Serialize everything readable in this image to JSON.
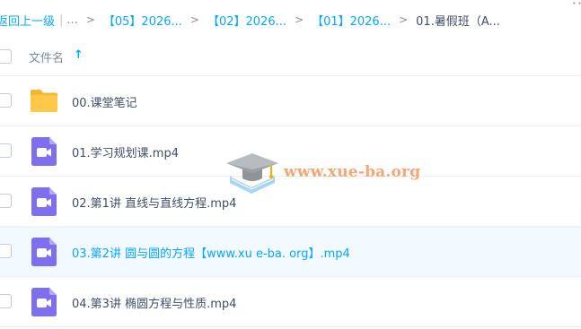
{
  "breadcrumb": {
    "back_label": "返回上一级",
    "divider": "|",
    "ellipsis": "...",
    "separator": ">",
    "items": [
      {
        "label": "【05】2026..."
      },
      {
        "label": "【02】2026..."
      },
      {
        "label": "【01】2026..."
      },
      {
        "label": "01.暑假班（A..."
      }
    ],
    "more_dots": "··"
  },
  "list_header": {
    "name_column": "文件名",
    "sort_icon": "arrow-up-icon",
    "sort_glyph": "↑"
  },
  "rows": [
    {
      "type": "folder",
      "icon": "folder-icon",
      "name": "00.课堂笔记"
    },
    {
      "type": "video",
      "icon": "video-file-icon",
      "name": "01.学习规划课.mp4"
    },
    {
      "type": "video",
      "icon": "video-file-icon",
      "name": "02.第1讲 直线与直线方程.mp4"
    },
    {
      "type": "video",
      "icon": "video-file-icon",
      "name": "03.第2讲 圆与圆的方程【www.xu e-ba. org】.mp4",
      "highlighted": true
    },
    {
      "type": "video",
      "icon": "video-file-icon",
      "name": "04.第3讲 椭圆方程与性质.mp4"
    }
  ],
  "watermark": {
    "text": "www.xue-ba.org",
    "icon": "graduation-cap-book-icon"
  },
  "colors": {
    "accent": "#06a7ff",
    "text": "#424e67",
    "folder": "#ffc33f",
    "video_icon": "#7e6ef0",
    "highlight_row": "#f2faff",
    "watermark": "#f3a676"
  }
}
